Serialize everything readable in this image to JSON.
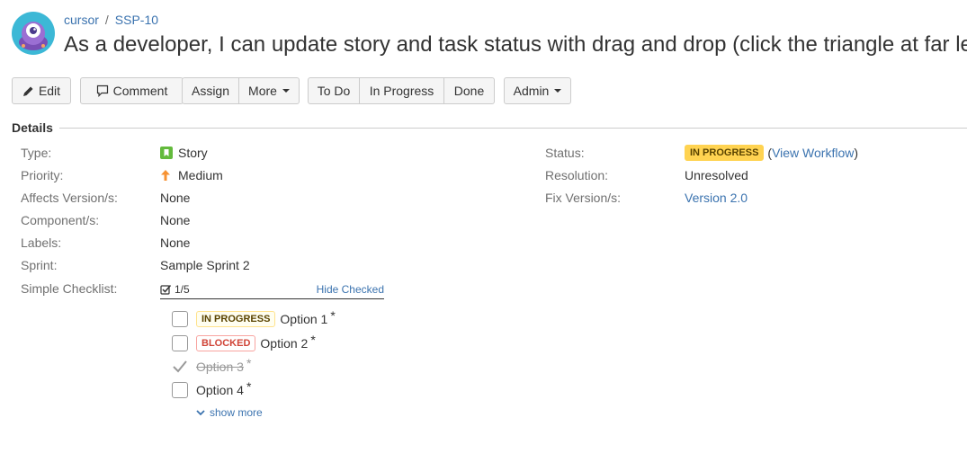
{
  "breadcrumb": {
    "project": "cursor",
    "separator": "/",
    "issue_key": "SSP-10"
  },
  "issue": {
    "title": "As a developer, I can update story and task status with drag and drop (click the triangle at far left"
  },
  "toolbar": {
    "edit": "Edit",
    "comment": "Comment",
    "assign": "Assign",
    "more": "More",
    "todo": "To Do",
    "in_progress": "In Progress",
    "done": "Done",
    "admin": "Admin"
  },
  "details": {
    "heading": "Details",
    "left": [
      {
        "label": "Type:",
        "value": "Story",
        "icon": "story-icon"
      },
      {
        "label": "Priority:",
        "value": "Medium",
        "icon": "priority-up-arrow-icon"
      },
      {
        "label": "Affects Version/s:",
        "value": "None"
      },
      {
        "label": "Component/s:",
        "value": "None"
      },
      {
        "label": "Labels:",
        "value": "None"
      },
      {
        "label": "Sprint:",
        "value": "Sample Sprint 2"
      },
      {
        "label": "Simple Checklist:"
      }
    ],
    "right": {
      "status_label": "Status:",
      "status_value": "IN PROGRESS",
      "view_workflow": "View Workflow",
      "resolution_label": "Resolution:",
      "resolution_value": "Unresolved",
      "fix_label": "Fix Version/s:",
      "fix_value": "Version 2.0"
    }
  },
  "checklist": {
    "progress": "1/5",
    "hide_checked": "Hide Checked",
    "items": [
      {
        "status": "IN PROGRESS",
        "text": "Option 1",
        "checked": false,
        "star": "*"
      },
      {
        "status": "BLOCKED",
        "text": "Option 2",
        "checked": false,
        "star": "*"
      },
      {
        "text": "Option 3",
        "checked": true,
        "star": "*"
      },
      {
        "text": "Option 4",
        "checked": false,
        "star": "*"
      }
    ],
    "show_more": "show more"
  },
  "colors": {
    "link": "#3b73af",
    "status_yellow": "#ffd351",
    "blocked_red": "#d04437",
    "story_green": "#63ba3c",
    "priority_orange": "#f79232"
  }
}
